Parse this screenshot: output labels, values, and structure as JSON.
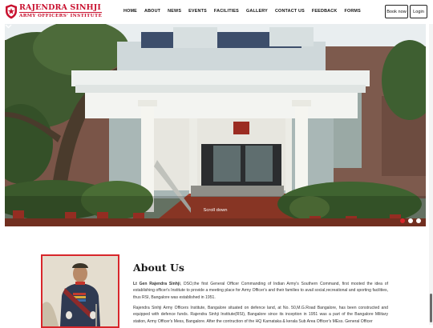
{
  "brand": {
    "line1": "RAJENDRA SINHJI",
    "line2": "ARMY OFFICERS' INSTITUTE",
    "color": "#c8102e"
  },
  "nav": {
    "home": "HOME",
    "about": "ABOUT",
    "news": "NEWS",
    "events": "EVENTS",
    "facilities": "FACILITIES",
    "gallery": "GALLERY",
    "contact": "CONTACT US",
    "feedback": "FEEDBACK",
    "forms": "FORMS"
  },
  "header_buttons": {
    "book_now": "Book now",
    "login": "Login"
  },
  "hero": {
    "scroll_label": "Scroll down",
    "slides_total": 3,
    "active_slide": 1,
    "accent": "#d8262b"
  },
  "about": {
    "title": "About Us",
    "p1_name": "Lt Gen Rajendra Sinhji",
    "p1_rest": ", DSO,the first General Officer Commanding of Indian Army's Southern Command, first mooted the idea of establishing officer's Institute to provide a meeting place for Army Officer's and their families to avail social,recreational and sporting facilities, thus RSI, Bangalore was established in 1951.",
    "p2": "Rajendra Sinhji Army Officers Institute, Bangalore situated on defence land, at No. 50,M.G.Road Bangalore, has been constructed and equipped with defence funds. Rajendra Sinhji Institute(RSI), Bangalore since its inception in 1951 was a part of the Bangalore Military station, Army Officer's Mess, Bangalore. After the contruction of the HQ Karnataka & kerala Sub Area Officer's MEss. General Officer"
  }
}
